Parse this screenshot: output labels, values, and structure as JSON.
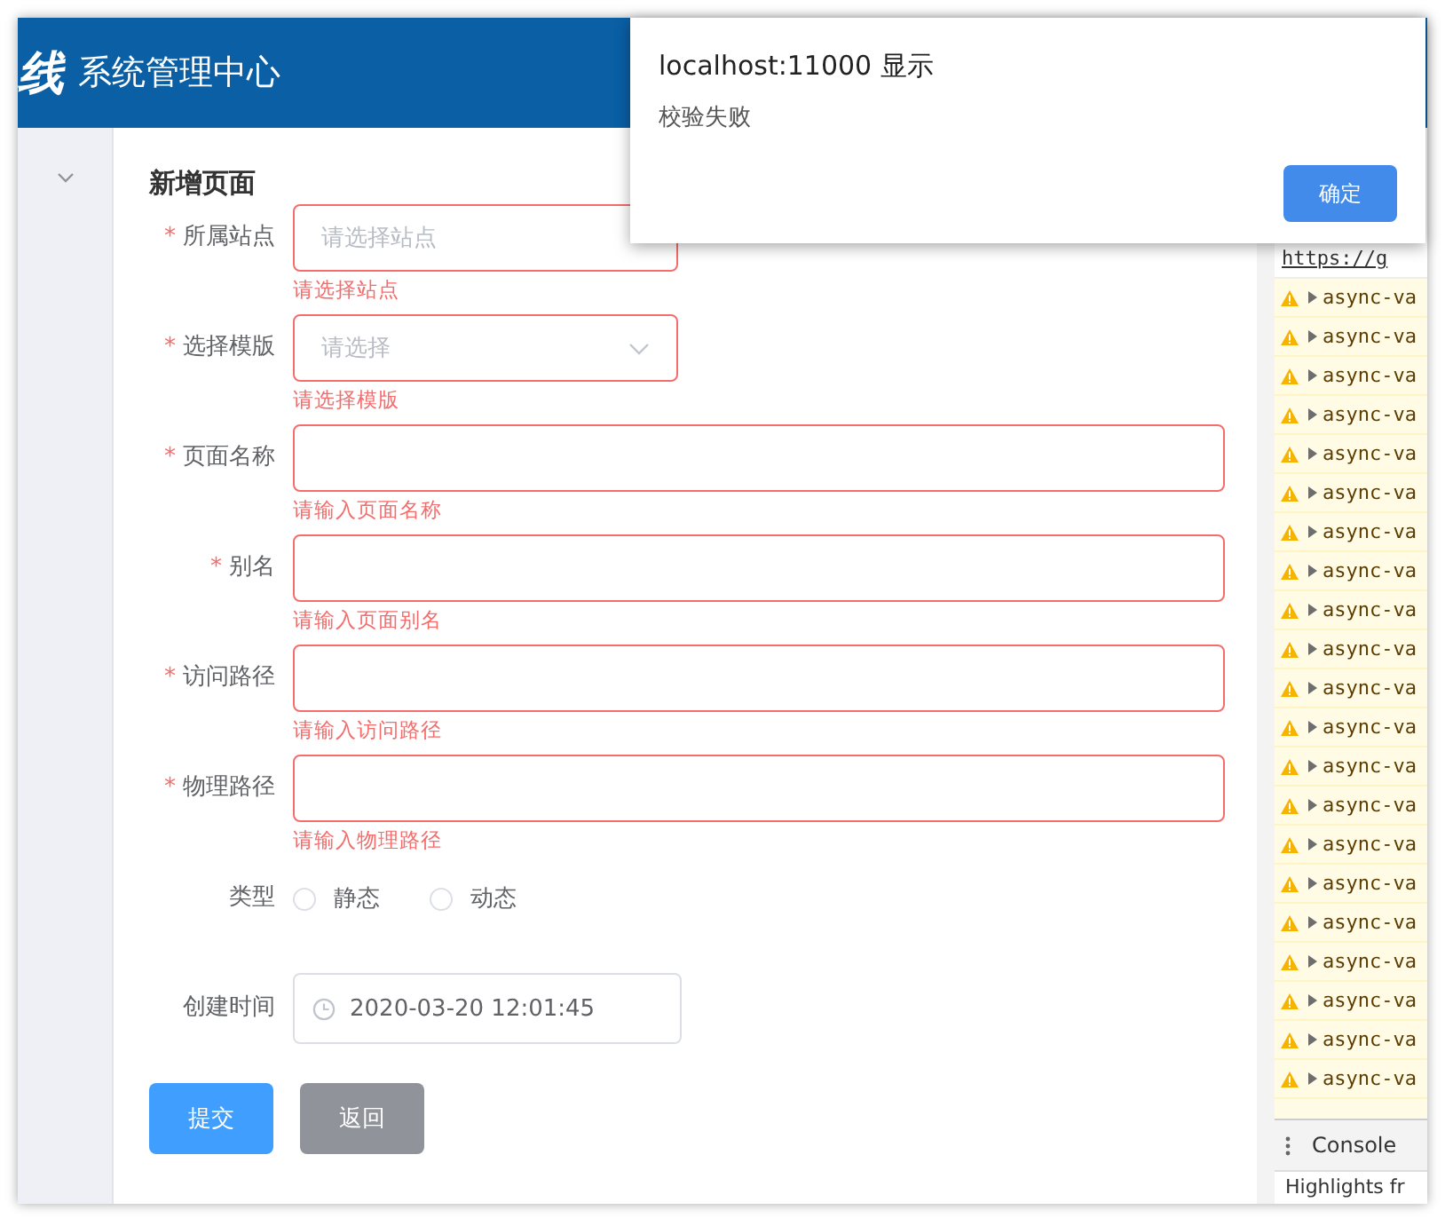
{
  "header": {
    "logo": "线",
    "title": "系统管理中心"
  },
  "form": {
    "title": "新增页面",
    "fields": [
      {
        "kind": "select",
        "mark": "*",
        "label": "所属站点",
        "placeholder": "请选择站点",
        "error": "请选择站点",
        "caret": false
      },
      {
        "kind": "select",
        "mark": "*",
        "label": "选择模版",
        "placeholder": "请选择",
        "error": "请选择模版",
        "caret": true
      },
      {
        "kind": "input",
        "mark": "*",
        "label": "页面名称",
        "error": "请输入页面名称"
      },
      {
        "kind": "input",
        "mark": "*",
        "label": "别名",
        "error": "请输入页面别名"
      },
      {
        "kind": "input",
        "mark": "*",
        "label": "访问路径",
        "error": "请输入访问路径"
      },
      {
        "kind": "input",
        "mark": "*",
        "label": "物理路径",
        "error": "请输入物理路径"
      }
    ],
    "type": {
      "label": "类型",
      "options": [
        {
          "label": "静态",
          "selected": false
        },
        {
          "label": "动态",
          "selected": false
        }
      ]
    },
    "created": {
      "label": "创建时间",
      "value": "2020-03-20 12:01:45"
    },
    "buttons": [
      {
        "kind": "primary",
        "label": "提交"
      },
      {
        "kind": "secondary",
        "label": "返回"
      }
    ]
  },
  "devtools": {
    "link": "https://g",
    "rows": [
      "async-va",
      "async-va",
      "async-va",
      "async-va",
      "async-va",
      "async-va",
      "async-va",
      "async-va",
      "async-va",
      "async-va",
      "async-va",
      "async-va",
      "async-va",
      "async-va",
      "async-va",
      "async-va",
      "async-va",
      "async-va",
      "async-va",
      "async-va",
      "async-va"
    ],
    "drawer_tab": "Console",
    "footer": "Highlights fr"
  },
  "dialog": {
    "title": "localhost:11000 显示",
    "message": "校验失败",
    "button": "确定"
  }
}
